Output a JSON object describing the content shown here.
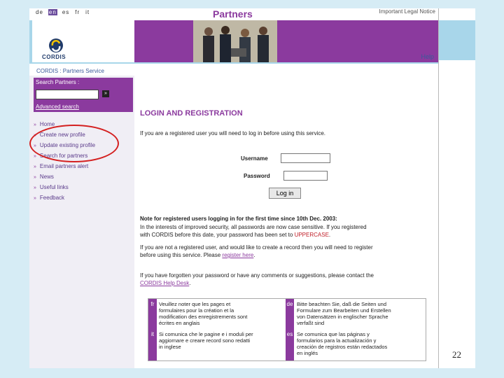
{
  "header": {
    "languages": [
      "de",
      "en",
      "es",
      "fr",
      "it"
    ],
    "active_language": "en",
    "legal_notice": "Important Legal Notice",
    "title": "Partners",
    "logo_text": "CORDIS",
    "help": "Help"
  },
  "breadcrumb": "CORDIS : Partners Service",
  "search": {
    "title": "Search Partners :",
    "go": "»",
    "advanced": "Advanced search"
  },
  "nav": {
    "items": [
      "Home",
      "Create new profile",
      "Update existing profile",
      "Search for partners",
      "Email partners alert",
      "News",
      "Useful links",
      "Feedback"
    ]
  },
  "main": {
    "title": "LOGIN AND REGISTRATION",
    "intro": "If you are a registered user you will need to log in before using this service.",
    "username_label": "Username",
    "password_label": "Password",
    "login_button": "Log in",
    "note_title": "Note for registered users logging in for the first time since 10th Dec. 2003:",
    "note_line1": "In the interests of improved security, all passwords are now case sensitive. If you registered",
    "note_line2a": "with CORDIS before this date, your password has been set to ",
    "note_uppercase": "UPPERCASE",
    "note_line2b": ".",
    "unreg_line1": "If you are not a registered user, and would like to create a record then you will need to register",
    "unreg_line2a": "before using this service. Please ",
    "register_link": "register here",
    "unreg_line2b": ".",
    "forgot_line1": "If you have forgotten your password or have any comments or suggestions, please contact the",
    "helpdesk_link": "CORDIS Help Desk",
    "forgot_line2b": "."
  },
  "lang_notes": {
    "fr_code": "fr",
    "fr_text": [
      "Veuillez noter que les pages et",
      "formulaires pour la création et la",
      "modification des enregistrements sont",
      "écrites en anglais"
    ],
    "de_code": "de",
    "de_text": [
      "Bitte beachten Sie, daß die Seiten und",
      "Formulare zum Bearbeiten und Erstellen",
      "von Datensätzen in englischer Sprache",
      "verfaßt sind"
    ],
    "it_code": "it",
    "it_text": [
      "Si comunica che le pagine e i moduli per",
      "aggiornare e creare record sono redatti",
      "in inglese"
    ],
    "es_code": "es",
    "es_text": [
      "Se comunica que las páginas y",
      "formularios para la actualización y",
      "creación de registros están redactados",
      "en inglés"
    ]
  },
  "slide_number": "22"
}
